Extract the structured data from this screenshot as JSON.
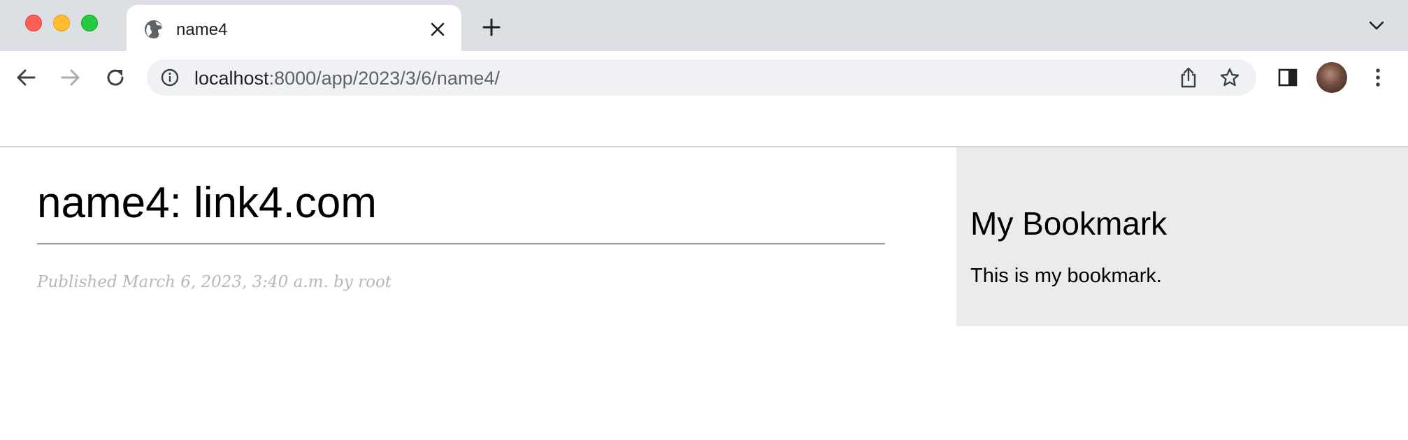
{
  "browser": {
    "tab": {
      "title": "name4"
    },
    "url": {
      "host": "localhost",
      "path": ":8000/app/2023/3/6/name4/"
    }
  },
  "post": {
    "title": "name4: link4.com",
    "meta": "Published March 6, 2023, 3:40 a.m. by root"
  },
  "sidebar": {
    "title": "My Bookmark",
    "text": "This is my bookmark."
  },
  "colors": {
    "tabstrip": "#dcdfe4",
    "omnibox": "#eff1f4",
    "sidebar_bg": "#ebebeb",
    "meta_text": "#b7b7b7",
    "close": "#fe5f57",
    "minimize": "#febc2e",
    "maximize": "#28c840"
  },
  "icons": [
    "close-icon",
    "globe-icon",
    "plus-icon",
    "chevron-down-icon",
    "back-arrow-icon",
    "forward-arrow-icon",
    "reload-icon",
    "info-icon",
    "share-icon",
    "star-icon",
    "side-panel-icon",
    "kebab-menu-icon"
  ]
}
